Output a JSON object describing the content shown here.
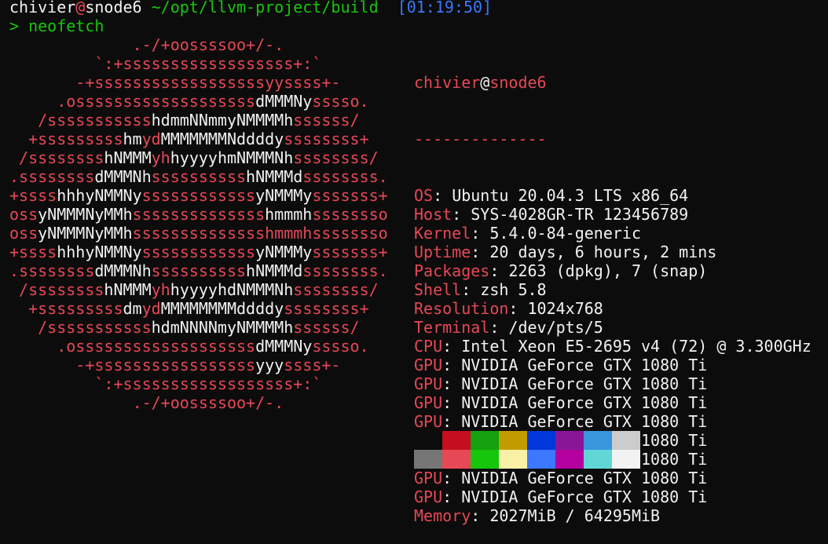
{
  "prompt": {
    "user": "chivier",
    "at": "@",
    "host": "snode6",
    "path": "~/opt/llvm-project/build",
    "time": "[01:19:50]",
    "symbol": ">",
    "command": "neofetch"
  },
  "ascii_logo": [
    [
      {
        "t": "             .-/+oossssoo+/-.",
        "c": "red"
      }
    ],
    [
      {
        "t": "         `:+ssssssssssssssssss+:`",
        "c": "red"
      }
    ],
    [
      {
        "t": "       -+ssssssssssssssssssyyssss+-",
        "c": "red"
      }
    ],
    [
      {
        "t": "     .osssssssssssssssssss",
        "c": "red"
      },
      {
        "t": "dMMMNy",
        "c": "white"
      },
      {
        "t": "sssso.",
        "c": "red"
      }
    ],
    [
      {
        "t": "   /sssssssssss",
        "c": "red"
      },
      {
        "t": "hdmmNNmmyNMMMMh",
        "c": "white"
      },
      {
        "t": "ssssss/",
        "c": "red"
      }
    ],
    [
      {
        "t": "  +sssssssss",
        "c": "red"
      },
      {
        "t": "hm",
        "c": "white"
      },
      {
        "t": "yd",
        "c": "red"
      },
      {
        "t": "MMMMMMMNddddy",
        "c": "white"
      },
      {
        "t": "ssssssss+",
        "c": "red"
      }
    ],
    [
      {
        "t": " /ssssssss",
        "c": "red"
      },
      {
        "t": "hNMMM",
        "c": "white"
      },
      {
        "t": "yh",
        "c": "red"
      },
      {
        "t": "hyyyyhmNMMMNh",
        "c": "white"
      },
      {
        "t": "ssssssss/",
        "c": "red"
      }
    ],
    [
      {
        "t": ".ssssssss",
        "c": "red"
      },
      {
        "t": "dMMMNh",
        "c": "white"
      },
      {
        "t": "ssssssssss",
        "c": "red"
      },
      {
        "t": "hNMMMd",
        "c": "white"
      },
      {
        "t": "ssssssss.",
        "c": "red"
      }
    ],
    [
      {
        "t": "+ssss",
        "c": "red"
      },
      {
        "t": "hhhyNMMNy",
        "c": "white"
      },
      {
        "t": "ssssssssssss",
        "c": "red"
      },
      {
        "t": "yNMMMy",
        "c": "white"
      },
      {
        "t": "sssssss+",
        "c": "red"
      }
    ],
    [
      {
        "t": "oss",
        "c": "red"
      },
      {
        "t": "yNMMMNyMMh",
        "c": "white"
      },
      {
        "t": "ssssssssssssss",
        "c": "red"
      },
      {
        "t": "hmmmh",
        "c": "white"
      },
      {
        "t": "ssssssso",
        "c": "red"
      }
    ],
    [
      {
        "t": "oss",
        "c": "red"
      },
      {
        "t": "yNMMMNyMMh",
        "c": "white"
      },
      {
        "t": "sssssssssssssshmmmhssssssso",
        "c": "red"
      }
    ],
    [
      {
        "t": "+ssss",
        "c": "red"
      },
      {
        "t": "hhhyNMMNy",
        "c": "white"
      },
      {
        "t": "ssssssssssss",
        "c": "red"
      },
      {
        "t": "yNMMMy",
        "c": "white"
      },
      {
        "t": "sssssss+",
        "c": "red"
      }
    ],
    [
      {
        "t": ".ssssssss",
        "c": "red"
      },
      {
        "t": "dMMMNh",
        "c": "white"
      },
      {
        "t": "ssssssssss",
        "c": "red"
      },
      {
        "t": "hNMMMd",
        "c": "white"
      },
      {
        "t": "ssssssss.",
        "c": "red"
      }
    ],
    [
      {
        "t": " /ssssssss",
        "c": "red"
      },
      {
        "t": "hNMMM",
        "c": "white"
      },
      {
        "t": "yh",
        "c": "red"
      },
      {
        "t": "hyyyyhdNMMMNh",
        "c": "white"
      },
      {
        "t": "ssssssss/",
        "c": "red"
      }
    ],
    [
      {
        "t": "  +sssssssss",
        "c": "red"
      },
      {
        "t": "dm",
        "c": "white"
      },
      {
        "t": "yd",
        "c": "red"
      },
      {
        "t": "MMMMMMMMddddy",
        "c": "white"
      },
      {
        "t": "ssssssss+",
        "c": "red"
      }
    ],
    [
      {
        "t": "   /sssssssssss",
        "c": "red"
      },
      {
        "t": "hdmNNNNmyNMMMMh",
        "c": "white"
      },
      {
        "t": "ssssss/",
        "c": "red"
      }
    ],
    [
      {
        "t": "     .osssssssssssssssssss",
        "c": "red"
      },
      {
        "t": "dMMMNy",
        "c": "white"
      },
      {
        "t": "sssso.",
        "c": "red"
      }
    ],
    [
      {
        "t": "       -+sssssssssssssssss",
        "c": "red"
      },
      {
        "t": "yyy",
        "c": "white"
      },
      {
        "t": "ssss+-",
        "c": "red"
      }
    ],
    [
      {
        "t": "         `:+ssssssssssssssssss+:`",
        "c": "red"
      }
    ],
    [
      {
        "t": "             .-/+oossssoo+/-.",
        "c": "red"
      }
    ]
  ],
  "info": {
    "user": "chivier",
    "at": "@",
    "host": "snode6",
    "separator": "--------------",
    "fields": [
      {
        "key": "OS",
        "value": "Ubuntu 20.04.3 LTS x86_64"
      },
      {
        "key": "Host",
        "value": "SYS-4028GR-TR 123456789"
      },
      {
        "key": "Kernel",
        "value": "5.4.0-84-generic"
      },
      {
        "key": "Uptime",
        "value": "20 days, 6 hours, 2 mins"
      },
      {
        "key": "Packages",
        "value": "2263 (dpkg), 7 (snap)"
      },
      {
        "key": "Shell",
        "value": "zsh 5.8"
      },
      {
        "key": "Resolution",
        "value": "1024x768"
      },
      {
        "key": "Terminal",
        "value": "/dev/pts/5"
      },
      {
        "key": "CPU",
        "value": "Intel Xeon E5-2695 v4 (72) @ 3.300GHz"
      },
      {
        "key": "GPU",
        "value": "NVIDIA GeForce GTX 1080 Ti"
      },
      {
        "key": "GPU",
        "value": "NVIDIA GeForce GTX 1080 Ti"
      },
      {
        "key": "GPU",
        "value": "NVIDIA GeForce GTX 1080 Ti"
      },
      {
        "key": "GPU",
        "value": "NVIDIA GeForce GTX 1080 Ti"
      },
      {
        "key": "GPU",
        "value": "NVIDIA GeForce GTX 1080 Ti"
      },
      {
        "key": "GPU",
        "value": "NVIDIA GeForce GTX 1080 Ti"
      },
      {
        "key": "GPU",
        "value": "NVIDIA GeForce GTX 1080 Ti"
      },
      {
        "key": "GPU",
        "value": "NVIDIA GeForce GTX 1080 Ti"
      },
      {
        "key": "Memory",
        "value": "2027MiB / 64295MiB"
      }
    ]
  },
  "palette": [
    "#0c0c0c",
    "#c50f1f",
    "#13a10e",
    "#c19c00",
    "#0037da",
    "#881798",
    "#3a96dd",
    "#cccccc",
    "#767676",
    "#e74856",
    "#16c60c",
    "#f9f1a5",
    "#3b78ff",
    "#b4009e",
    "#61d6d6",
    "#f2f2f2"
  ],
  "colors": {
    "background": "#0c0c0c",
    "foreground": "#cccccc",
    "accent_red": "#e74856",
    "prompt_green": "#16c60c",
    "time_blue": "#3b78ff"
  }
}
